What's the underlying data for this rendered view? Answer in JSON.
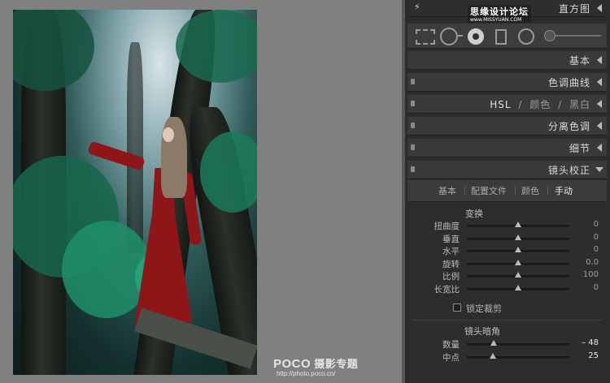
{
  "histogram": {
    "label": "直方图"
  },
  "site_badge": {
    "line1": "思缘设计论坛",
    "line2": "www.MISSYUAN.COM"
  },
  "panels": [
    {
      "label": "基本",
      "id": "basic"
    },
    {
      "label": "色调曲线",
      "id": "tone"
    },
    {
      "label": "HSL / 颜色 / 黑白",
      "id": "hsl"
    },
    {
      "label": "分离色调",
      "id": "split"
    },
    {
      "label": "细节",
      "id": "detail"
    },
    {
      "label": "镜头校正",
      "id": "lens"
    }
  ],
  "hsl": {
    "hsl": "HSL",
    "color": "颜色",
    "bw": "黑白",
    "slash": "/"
  },
  "lens": {
    "tabs": [
      "基本",
      "配置文件",
      "颜色",
      "手动"
    ],
    "active_tab": "手动",
    "transform_title": "变换",
    "transform": [
      {
        "label": "扭曲度",
        "value": "0",
        "pos": 0.5
      },
      {
        "label": "垂直",
        "value": "0",
        "pos": 0.5
      },
      {
        "label": "水平",
        "value": "0",
        "pos": 0.5
      },
      {
        "label": "旋转",
        "value": "0.0",
        "pos": 0.5
      },
      {
        "label": "比例",
        "value": "100",
        "pos": 0.5
      },
      {
        "label": "长宽比",
        "value": "0",
        "pos": 0.5
      }
    ],
    "lock_crop": "锁定裁剪",
    "vignette_title": "镜头暗角",
    "vignette": [
      {
        "label": "数量",
        "value": "– 48",
        "pos": 0.26
      },
      {
        "label": "中点",
        "value": "25",
        "pos": 0.25
      }
    ]
  },
  "watermark": {
    "brand": "POCO",
    "title": "摄影专题",
    "url": "http://photo.poco.cn/"
  },
  "colors": {
    "panel": "#2c2c2c",
    "header": "#3a3a3a",
    "dress": "#8e1518",
    "foliage": "#1f8f6a"
  }
}
